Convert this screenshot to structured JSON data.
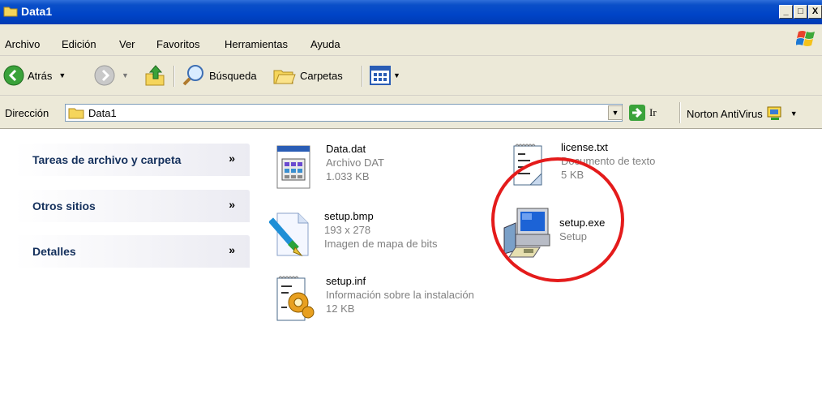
{
  "window": {
    "title": "Data1",
    "minimize": "_",
    "maximize": "□",
    "close": "X"
  },
  "menu": [
    "Archivo",
    "Edición",
    "Ver",
    "Favoritos",
    "Herramientas",
    "Ayuda"
  ],
  "toolbar": {
    "back": "Atrás",
    "search": "Búsqueda",
    "folders": "Carpetas"
  },
  "address": {
    "label": "Dirección",
    "value": "Data1",
    "go": "Ir",
    "norton": "Norton AntiVirus"
  },
  "tasks": [
    {
      "title": "Tareas de archivo y carpeta",
      "chevron": "»"
    },
    {
      "title": "Otros sitios",
      "chevron": "»"
    },
    {
      "title": "Detalles",
      "chevron": "»"
    }
  ],
  "files": [
    {
      "name": "Data.dat",
      "type": "Archivo DAT",
      "size": "1.033 KB",
      "icon": "dat-file-icon"
    },
    {
      "name": "license.txt",
      "type": "Documento de texto",
      "size": "5 KB",
      "icon": "text-document-icon"
    },
    {
      "name": "setup.bmp",
      "dims": "193 x 278",
      "type": "Imagen de mapa de bits",
      "icon": "bitmap-image-icon"
    },
    {
      "name": "setup.exe",
      "type": "Setup",
      "icon": "setup-computer-icon"
    },
    {
      "name": "setup.inf",
      "type": "Información sobre la instalación",
      "size": "12 KB",
      "icon": "setup-info-icon"
    }
  ],
  "colors": {
    "titlebar": "#0044c7",
    "chrome": "#ece9d8",
    "task_title": "#215dc6",
    "highlight": "#e41b1b"
  }
}
